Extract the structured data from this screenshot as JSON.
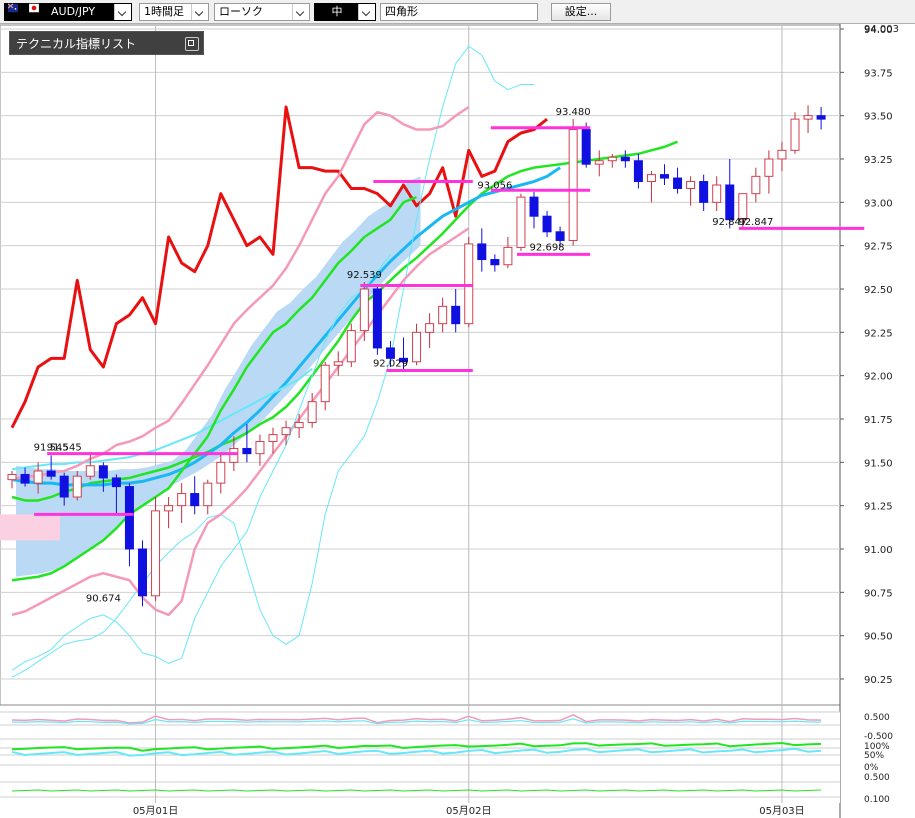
{
  "toolbar": {
    "symbol": "AUD/JPY",
    "timeframe": "1時間足",
    "chart_type": "ローソク",
    "mid_label": "中",
    "shape": "四角形",
    "settings_label": "設定..."
  },
  "indicator_panel": {
    "title": "テクニカル指標リスト"
  },
  "price_axis_top_label": "94.003",
  "colors": {
    "up_candle": "#d04050",
    "down_candle": "#1010e0",
    "cloud": "#b9d9f5",
    "cloud_bear": "#fbd0e2",
    "red_line": "#e81010",
    "magenta_level": "#ff33dd",
    "green_ma": "#22e522",
    "cyan_line": "#1ab8f2",
    "bollinger_outer": "#66e8f8",
    "bollinger_inner": "#f49ab8"
  },
  "chart_data": {
    "type": "candlestick",
    "symbol": "AUD/JPY",
    "timeframe": "1時間足",
    "ylim": [
      90.1,
      94.0
    ],
    "y_ticks": [
      "94.00",
      "93.75",
      "93.50",
      "93.25",
      "93.00",
      "92.75",
      "92.50",
      "92.25",
      "92.00",
      "91.75",
      "91.50",
      "91.25",
      "91.00",
      "90.75",
      "90.50",
      "90.25"
    ],
    "x_labels": [
      {
        "label": "05月01日",
        "bar": 11
      },
      {
        "label": "05月02日",
        "bar": 35
      },
      {
        "label": "05月03日",
        "bar": 59
      }
    ],
    "annotations": [
      {
        "text": "91.545",
        "value": 91.545,
        "bar": 4
      },
      {
        "text": "91.545",
        "value": 91.545,
        "bar": 3
      },
      {
        "text": "90.674",
        "value": 90.674,
        "bar": 7
      },
      {
        "text": "92.539",
        "value": 92.539,
        "bar": 27
      },
      {
        "text": "92.029",
        "value": 92.029,
        "bar": 29
      },
      {
        "text": "93.056",
        "value": 93.056,
        "bar": 37
      },
      {
        "text": "92.698",
        "value": 92.698,
        "bar": 41
      },
      {
        "text": "93.480",
        "value": 93.48,
        "bar": 43
      },
      {
        "text": "92.847",
        "value": 92.847,
        "bar": 55
      },
      {
        "text": "92.847",
        "value": 92.847,
        "bar": 57
      }
    ],
    "levels": [
      {
        "value": 91.55,
        "from": 3,
        "to": 17
      },
      {
        "value": 91.2,
        "from": 2,
        "to": 9
      },
      {
        "value": 93.12,
        "from": 28,
        "to": 35
      },
      {
        "value": 92.52,
        "from": 27,
        "to": 35
      },
      {
        "value": 92.03,
        "from": 29,
        "to": 35
      },
      {
        "value": 93.43,
        "from": 37,
        "to": 44
      },
      {
        "value": 93.07,
        "from": 37,
        "to": 44
      },
      {
        "value": 92.7,
        "from": 39,
        "to": 44
      },
      {
        "value": 92.85,
        "from": 56,
        "to": 65
      }
    ],
    "ohlc": [
      [
        91.4,
        91.45,
        91.35,
        91.43
      ],
      [
        91.43,
        91.47,
        91.36,
        91.38
      ],
      [
        91.38,
        91.5,
        91.32,
        91.45
      ],
      [
        91.45,
        91.54,
        91.4,
        91.42
      ],
      [
        91.42,
        91.44,
        91.25,
        91.3
      ],
      [
        91.3,
        91.45,
        91.28,
        91.42
      ],
      [
        91.42,
        91.56,
        91.4,
        91.48
      ],
      [
        91.48,
        91.5,
        91.33,
        91.41
      ],
      [
        91.41,
        91.43,
        91.2,
        91.36
      ],
      [
        91.36,
        91.38,
        90.9,
        91.0
      ],
      [
        91.0,
        91.05,
        90.67,
        90.73
      ],
      [
        90.73,
        91.3,
        90.7,
        91.22
      ],
      [
        91.22,
        91.3,
        91.12,
        91.25
      ],
      [
        91.25,
        91.38,
        91.15,
        91.32
      ],
      [
        91.32,
        91.42,
        91.2,
        91.25
      ],
      [
        91.25,
        91.4,
        91.2,
        91.38
      ],
      [
        91.38,
        91.55,
        91.32,
        91.5
      ],
      [
        91.5,
        91.65,
        91.45,
        91.58
      ],
      [
        91.58,
        91.72,
        91.5,
        91.55
      ],
      [
        91.55,
        91.66,
        91.48,
        91.62
      ],
      [
        91.62,
        91.7,
        91.55,
        91.66
      ],
      [
        91.66,
        91.74,
        91.6,
        91.7
      ],
      [
        91.7,
        91.78,
        91.64,
        91.73
      ],
      [
        91.73,
        91.9,
        91.7,
        91.85
      ],
      [
        91.85,
        92.08,
        91.8,
        92.06
      ],
      [
        92.06,
        92.14,
        92.0,
        92.08
      ],
      [
        92.08,
        92.3,
        92.05,
        92.26
      ],
      [
        92.26,
        92.54,
        92.2,
        92.5
      ],
      [
        92.5,
        92.52,
        92.12,
        92.16
      ],
      [
        92.16,
        92.2,
        92.05,
        92.1
      ],
      [
        92.1,
        92.22,
        92.03,
        92.08
      ],
      [
        92.08,
        92.3,
        92.06,
        92.25
      ],
      [
        92.25,
        92.36,
        92.16,
        92.3
      ],
      [
        92.3,
        92.45,
        92.25,
        92.4
      ],
      [
        92.4,
        92.5,
        92.25,
        92.3
      ],
      [
        92.3,
        92.8,
        92.28,
        92.76
      ],
      [
        92.76,
        92.85,
        92.6,
        92.67
      ],
      [
        92.67,
        92.7,
        92.6,
        92.64
      ],
      [
        92.64,
        92.8,
        92.62,
        92.74
      ],
      [
        92.74,
        93.05,
        92.72,
        93.03
      ],
      [
        93.03,
        93.06,
        92.85,
        92.92
      ],
      [
        92.92,
        92.95,
        92.8,
        92.83
      ],
      [
        92.83,
        92.86,
        92.74,
        92.78
      ],
      [
        92.78,
        93.48,
        92.75,
        93.42
      ],
      [
        93.42,
        93.46,
        93.2,
        93.22
      ],
      [
        93.22,
        93.3,
        93.15,
        93.24
      ],
      [
        93.24,
        93.28,
        93.2,
        93.26
      ],
      [
        93.26,
        93.3,
        93.2,
        93.24
      ],
      [
        93.24,
        93.28,
        93.08,
        93.12
      ],
      [
        93.12,
        93.18,
        93.0,
        93.16
      ],
      [
        93.16,
        93.22,
        93.1,
        93.14
      ],
      [
        93.14,
        93.2,
        93.05,
        93.08
      ],
      [
        93.08,
        93.15,
        92.98,
        93.12
      ],
      [
        93.12,
        93.16,
        92.95,
        93.0
      ],
      [
        93.0,
        93.15,
        92.95,
        93.1
      ],
      [
        93.1,
        93.25,
        92.85,
        92.9
      ],
      [
        92.9,
        93.05,
        92.85,
        93.05
      ],
      [
        93.05,
        93.2,
        93.0,
        93.15
      ],
      [
        93.15,
        93.3,
        93.05,
        93.25
      ],
      [
        93.25,
        93.35,
        93.18,
        93.3
      ],
      [
        93.3,
        93.52,
        93.28,
        93.48
      ],
      [
        93.48,
        93.56,
        93.4,
        93.5
      ],
      [
        93.5,
        93.55,
        93.42,
        93.48
      ]
    ],
    "series": [
      {
        "name": "red",
        "style": "thick",
        "start": 0,
        "values": [
          91.7,
          91.85,
          92.05,
          92.1,
          92.1,
          92.55,
          92.15,
          92.05,
          92.3,
          92.35,
          92.45,
          92.3,
          92.8,
          92.65,
          92.6,
          92.75,
          93.05,
          92.9,
          92.75,
          92.8,
          92.7,
          93.55,
          93.2,
          93.2,
          93.18,
          93.18,
          93.08,
          93.08,
          93.05,
          92.98,
          93.1,
          92.98,
          93.05,
          93.2,
          92.92,
          93.3,
          93.15,
          93.18,
          93.35,
          93.4,
          93.42,
          93.48
        ]
      },
      {
        "name": "green-mid",
        "start": 0,
        "values": [
          91.3,
          91.28,
          91.28,
          91.3,
          91.33,
          91.35,
          91.38,
          91.39,
          91.4,
          91.41,
          91.43,
          91.45,
          91.47,
          91.5,
          91.53,
          91.56,
          91.6,
          91.63,
          91.67,
          91.72,
          91.76,
          91.82,
          91.9,
          92.0,
          92.1,
          92.2,
          92.32,
          92.42,
          92.48,
          92.55,
          92.62,
          92.68,
          92.75,
          92.82,
          92.9,
          92.98,
          93.05,
          93.1,
          93.15,
          93.18,
          93.2,
          93.21,
          93.22,
          93.23,
          93.24,
          93.25,
          93.26,
          93.27,
          93.28,
          93.3,
          93.32,
          93.35
        ]
      },
      {
        "name": "cyan-mid",
        "start": 0,
        "values": [
          91.4,
          91.39,
          91.38,
          91.38,
          91.37,
          91.37,
          91.37,
          91.37,
          91.38,
          91.38,
          91.39,
          91.41,
          91.43,
          91.46,
          91.5,
          91.55,
          91.6,
          91.67,
          91.73,
          91.8,
          91.88,
          91.96,
          92.05,
          92.14,
          92.23,
          92.32,
          92.41,
          92.5,
          92.58,
          92.66,
          92.73,
          92.8,
          92.86,
          92.92,
          92.96,
          93.0,
          93.04,
          93.06,
          93.08,
          93.1,
          93.12,
          93.15,
          93.2
        ]
      },
      {
        "name": "cyan-slow",
        "start": 0,
        "values": [
          91.46,
          91.47,
          91.48,
          91.49,
          91.49,
          91.5,
          91.5,
          91.51,
          91.52,
          91.53,
          91.55,
          91.57,
          91.6,
          91.63,
          91.66,
          91.7,
          91.74,
          91.78,
          91.82,
          91.86,
          91.9,
          91.94,
          91.98,
          92.04
        ]
      },
      {
        "name": "green-slow",
        "start": 0,
        "values": [
          90.82,
          90.83,
          90.84,
          90.86,
          90.9,
          90.95,
          91.0,
          91.05,
          91.12,
          91.2,
          91.25,
          91.3,
          91.35,
          91.45,
          91.55,
          91.65,
          91.8,
          91.92,
          92.05,
          92.15,
          92.25,
          92.3,
          92.38,
          92.45,
          92.55,
          92.65,
          92.72,
          92.8,
          92.85,
          92.9,
          93.0,
          93.03
        ]
      },
      {
        "name": "bb-upper",
        "start": 0,
        "values": [
          90.26,
          90.3,
          90.35,
          90.4,
          90.45,
          90.47,
          90.48,
          90.52,
          90.6,
          90.7,
          90.8,
          90.9,
          90.98,
          91.05,
          91.1,
          91.18,
          91.2,
          91.15,
          90.9,
          90.65,
          90.5,
          90.45,
          90.5,
          90.8,
          91.2,
          91.45,
          91.55,
          91.65,
          91.85,
          92.1,
          92.5,
          92.9,
          93.25,
          93.55,
          93.8,
          93.9,
          93.85,
          93.7,
          93.65,
          93.68,
          93.68
        ]
      },
      {
        "name": "bb-upper-inner",
        "start": 0,
        "values": [
          91.4,
          91.42,
          91.42,
          91.44,
          91.45,
          91.48,
          91.52,
          91.55,
          91.6,
          91.62,
          91.65,
          91.7,
          91.74,
          91.84,
          91.95,
          92.06,
          92.18,
          92.3,
          92.38,
          92.45,
          92.52,
          92.62,
          92.75,
          92.9,
          93.05,
          93.15,
          93.3,
          93.45,
          93.52,
          93.5,
          93.45,
          93.42,
          93.42,
          93.44,
          93.5,
          93.55
        ]
      },
      {
        "name": "bb-lower-inner",
        "start": 0,
        "values": [
          90.62,
          90.64,
          90.68,
          90.72,
          90.76,
          90.8,
          90.84,
          90.86,
          90.84,
          90.82,
          90.72,
          90.65,
          90.62,
          90.7,
          91.0,
          91.15,
          91.2,
          91.27,
          91.35,
          91.45,
          91.55,
          91.65,
          91.75,
          91.85,
          91.95,
          92.05,
          92.15,
          92.25,
          92.35,
          92.45,
          92.55,
          92.63,
          92.7,
          92.75,
          92.8,
          92.85
        ]
      },
      {
        "name": "bb-lower",
        "start": 0,
        "values": [
          90.3,
          90.35,
          90.38,
          90.42,
          90.5,
          90.55,
          90.6,
          90.62,
          90.58,
          90.5,
          90.4,
          90.38,
          90.34,
          90.37,
          90.6,
          90.75,
          90.9,
          91.0,
          91.1,
          91.3,
          91.45,
          91.6,
          91.8,
          92.0,
          92.2,
          92.35,
          92.45,
          92.5,
          92.6,
          92.7
        ]
      }
    ]
  }
}
